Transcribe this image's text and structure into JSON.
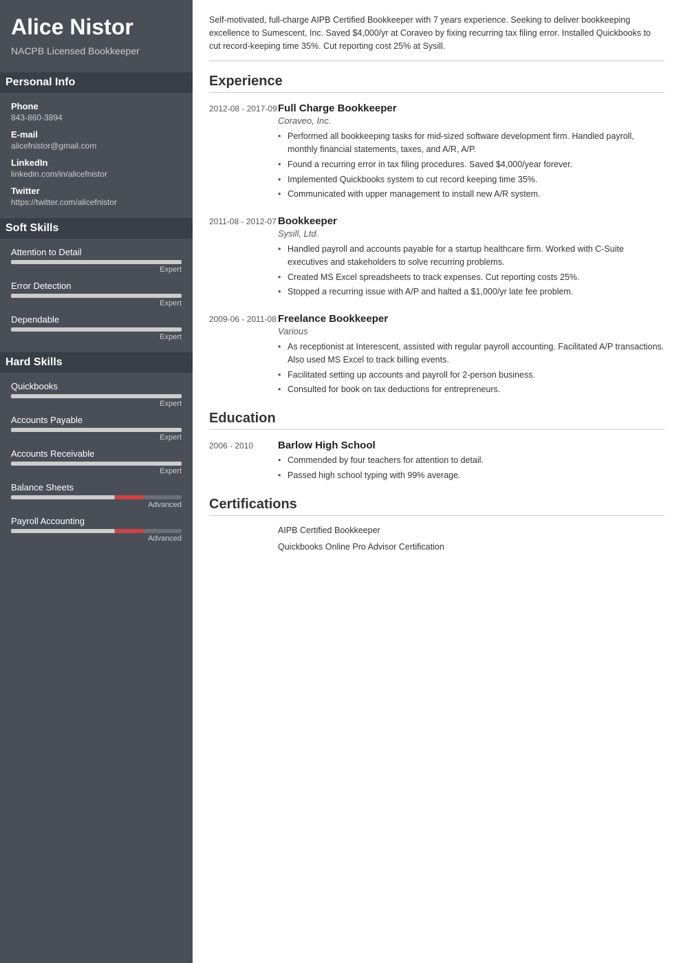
{
  "sidebar": {
    "name": "Alice Nistor",
    "title": "NACPB Licensed Bookkeeper",
    "sections": {
      "personal_info": "Personal Info",
      "soft_skills": "Soft Skills",
      "hard_skills": "Hard Skills"
    },
    "personal": {
      "phone_label": "Phone",
      "phone": "843-860-3894",
      "email_label": "E-mail",
      "email": "alicefnistor@gmail.com",
      "linkedin_label": "LinkedIn",
      "linkedin": "linkedin.com/in/alicefnistor",
      "twitter_label": "Twitter",
      "twitter": "https://twitter.com/alicefnistor"
    },
    "soft_skills": [
      {
        "name": "Attention to Detail",
        "level_label": "Expert",
        "percent": 100,
        "color": "#ccc"
      },
      {
        "name": "Error Detection",
        "level_label": "Expert",
        "percent": 100,
        "color": "#ccc"
      },
      {
        "name": "Dependable",
        "level_label": "Expert",
        "percent": 100,
        "color": "#ccc"
      }
    ],
    "hard_skills": [
      {
        "name": "Quickbooks",
        "level_label": "Expert",
        "percent": 100,
        "color": "#ccc"
      },
      {
        "name": "Accounts Payable",
        "level_label": "Expert",
        "percent": 100,
        "color": "#ccc"
      },
      {
        "name": "Accounts Receivable",
        "level_label": "Expert",
        "percent": 100,
        "color": "#ccc"
      },
      {
        "name": "Balance Sheets",
        "level_label": "Advanced",
        "percent": 78,
        "color": "#ccc",
        "accent": "#cc4444"
      },
      {
        "name": "Payroll Accounting",
        "level_label": "Advanced",
        "percent": 78,
        "color": "#ccc",
        "accent": "#cc4444"
      }
    ]
  },
  "main": {
    "summary": "Self-motivated, full-charge AIPB Certified Bookkeeper with 7 years experience. Seeking to deliver bookkeeping excellence to Sumescent, Inc. Saved $4,000/yr at Coraveo by fixing recurring tax filing error. Installed Quickbooks to cut record-keeping time 35%. Cut reporting cost 25% at Sysill.",
    "sections": {
      "experience": "Experience",
      "education": "Education",
      "certifications": "Certifications"
    },
    "experience": [
      {
        "dates": "2012-08 - 2017-09",
        "title": "Full Charge Bookkeeper",
        "company": "Coraveo, Inc.",
        "bullets": [
          "Performed all bookkeeping tasks for mid-sized software development firm. Handled payroll, monthly financial statements, taxes, and A/R, A/P.",
          "Found a recurring error in tax filing procedures. Saved $4,000/year forever.",
          "Implemented Quickbooks system to cut record keeping time 35%.",
          "Communicated with upper management to install new A/R system."
        ]
      },
      {
        "dates": "2011-08 - 2012-07",
        "title": "Bookkeeper",
        "company": "Sysill, Ltd.",
        "bullets": [
          "Handled payroll and accounts payable for a startup healthcare firm. Worked with C-Suite executives and stakeholders to solve recurring problems.",
          "Created MS Excel spreadsheets to track expenses. Cut reporting costs 25%.",
          "Stopped a recurring issue with A/P and halted a $1,000/yr late fee problem."
        ]
      },
      {
        "dates": "2009-06 - 2011-08",
        "title": "Freelance Bookkeeper",
        "company": "Various",
        "bullets": [
          "As receptionist at Interescent, assisted with regular payroll accounting. Facilitated A/P transactions. Also used MS Excel to track billing events.",
          "Facilitated setting up accounts and payroll for 2-person business.",
          "Consulted for book on tax deductions for entrepreneurs."
        ]
      }
    ],
    "education": [
      {
        "dates": "2006 - 2010",
        "school": "Barlow High School",
        "bullets": [
          "Commended by four teachers for attention to detail.",
          "Passed high school typing with 99% average."
        ]
      }
    ],
    "certifications": [
      "AIPB Certified Bookkeeper",
      "Quickbooks Online Pro Advisor Certification"
    ]
  }
}
